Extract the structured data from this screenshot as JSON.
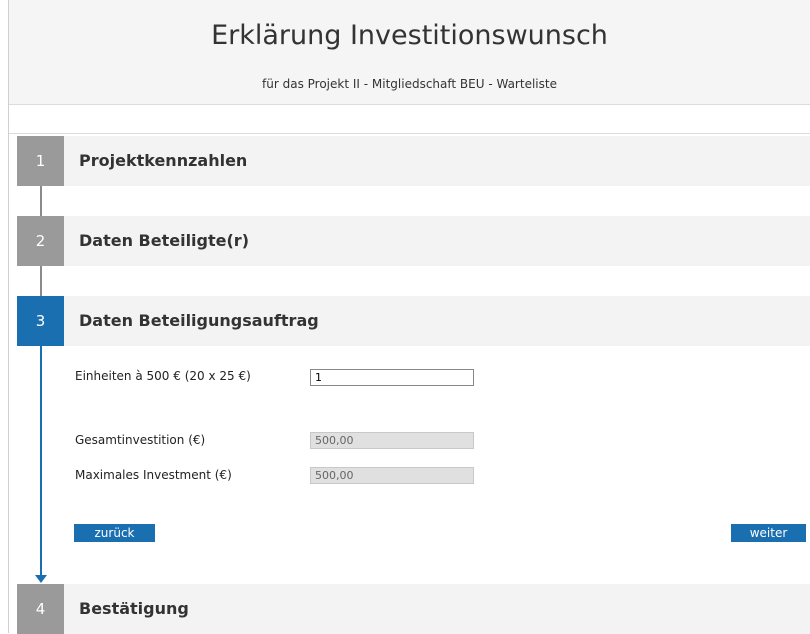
{
  "header": {
    "title": "Erklärung Investitionswunsch",
    "subtitle": "für das Projekt II - Mitgliedschaft BEU - Warteliste"
  },
  "steps": [
    {
      "number": "1",
      "title": "Projektkennzahlen"
    },
    {
      "number": "2",
      "title": "Daten Beteiligte(r)"
    },
    {
      "number": "3",
      "title": "Daten Beteiligungsauftrag"
    },
    {
      "number": "4",
      "title": "Bestätigung"
    }
  ],
  "form": {
    "units_label": "Einheiten à 500 € (20 x 25 €)",
    "units_value": "1",
    "total_label": "Gesamtinvestition (€)",
    "total_value": "500,00",
    "max_label": "Maximales Investment (€)",
    "max_value": "500,00"
  },
  "buttons": {
    "back": "zurück",
    "next": "weiter"
  },
  "colors": {
    "active_step": "#1a6fb0",
    "inactive_step": "#9a9a9a"
  }
}
